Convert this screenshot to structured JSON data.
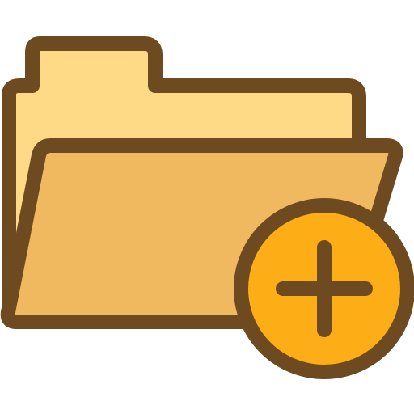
{
  "icon": {
    "name": "add-folder-icon",
    "parts": {
      "folder_back": "folder-back-icon-part",
      "folder_front": "folder-front-icon-part",
      "badge": "add-badge-icon-part",
      "plus": "plus-icon"
    }
  },
  "colors": {
    "outline": "#6e4a21",
    "folder_back_fill": "#fed986",
    "folder_front_fill": "#f0b95f",
    "badge_fill": "#fdad15",
    "background": "#ffffff"
  }
}
